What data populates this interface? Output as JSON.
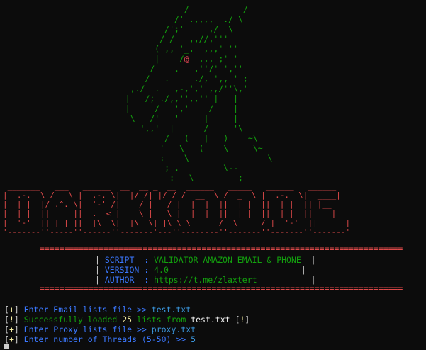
{
  "ascii": {
    "dragon_lines": [
      "               /           /",
      "             /' .,,,,  ./ \\",
      "           /';'     ,/  \\",
      "          / /   ,,//,'''",
      "         ( ,, '_,  ,,,' ''",
      "         |    /@  ,,, ;' '",
      "        /    .   ,''/' ',''",
      "       /   .     ./, ',, ' ;",
      "    ,./  .   ,-,',' ,,/''\\,'",
      "   |   /; ./,,'',,'' |   |",
      "   |     /   ','    /    |",
      "    \\___/'   '     |     |",
      "      ',,'  |      /     '\\",
      "           /   (   |   )    ~\\",
      "          '   \\   (    \\     \\~",
      "          :    \\                \\",
      "           ; .         \\--",
      "            :   \\         ;"
    ],
    "banner_lines": [
      " _______   ___   ______  __  __ _  __  ______   _____   ______   ______",
      "|  .-.  \\ /   \\ |  .-. \\|  |/ /| |/ / /  __  \\ /  _  \\ |  .-.  \\|  ____|",
      "|  | |  |/ .^. \\|  '-' /|    / |   / |  |  |  ||  | |  ||  | |  || |__",
      "|  | |  ||  _  ||  .  < |    \\ |   \\ |  |__|  ||  |_|  ||  | |  ||  __|",
      "|  '-'  ||_| |_||__|\\__\\|__|\\__\\|_|\\_\\ \\______/  \\_____/ |  '-'  ||______|",
      "'-------''-----''------''-------'---''--------''-------''-------''-------'"
    ]
  },
  "rule": "==========================================================================",
  "info": [
    {
      "key": "SCRIPT ",
      "value": "VALIDATOR AMAZON EMAIL & PHONE"
    },
    {
      "key": "VERSION",
      "value": "4.0"
    },
    {
      "key": "AUTHOR ",
      "value": "https://t.me/zlaxtert"
    }
  ],
  "log": {
    "line1": {
      "tag": "+",
      "msg": "Enter Email lists file >> ",
      "input": "test.txt"
    },
    "line2": {
      "tag": "!",
      "msg_a": "Successfully loaded ",
      "count": "25",
      "msg_b": " lists from ",
      "file": "test.txt",
      "tag2": "!"
    },
    "line3": {
      "tag": "+",
      "msg": "Enter Proxy lists file >> ",
      "input": "proxy.txt"
    },
    "line4": {
      "tag": "+",
      "msg": "Enter number of Threads (5-50) >> ",
      "input": "5"
    }
  }
}
